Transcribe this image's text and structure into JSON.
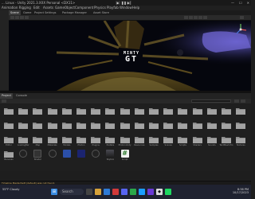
{
  "titlebar": {
    "title": "... Linux - Unity 2021.3.XXX Personal <DX11>",
    "play": "▶",
    "pause": "❚❚",
    "step": "▶|",
    "min": "—",
    "max": "☐",
    "close": "✕"
  },
  "menu": [
    "Animation Rigging",
    "Edit",
    "Assets",
    "GameObject",
    "Component",
    "Physics",
    "Playfab",
    "Window",
    "Help"
  ],
  "scene_tabs": [
    "Scene",
    "Game",
    "Project Settings",
    "Package Manager",
    "Asset Store"
  ],
  "logo": {
    "line1": "MINTY",
    "line2": "GT"
  },
  "project_tabs": [
    "Project",
    "Console"
  ],
  "assets": {
    "folder_rows": [
      [
        "",
        "",
        "",
        "",
        "",
        "",
        "",
        "",
        "",
        "",
        "",
        "",
        "",
        "",
        "",
        "",
        ""
      ],
      [
        "",
        "",
        "",
        "",
        "",
        "",
        "",
        "",
        "",
        "",
        "",
        "",
        "",
        "",
        "",
        "",
        ""
      ],
      [
        "Editor",
        "LoadingBar",
        "Map",
        "Materials",
        "Models",
        "Photon",
        "Plugins",
        "Prefabs",
        "PhotonUnity",
        "Resources",
        "Samples",
        "Scenes",
        "Scripts",
        "Shaders",
        "Sounds",
        "TextMesh Pro",
        "Textures"
      ]
    ],
    "file_row": [
      {
        "label": "Bananas",
        "kind": "folder"
      },
      {
        "label": "",
        "kind": "round-dark"
      },
      {
        "label": "Shader",
        "kind": "dark"
      },
      {
        "label": "",
        "kind": "round-dark"
      },
      {
        "label": "",
        "kind": "blue"
      },
      {
        "label": "",
        "kind": "deepblue"
      },
      {
        "label": "",
        "kind": "round-dark"
      },
      {
        "label": "Skybox",
        "kind": "sky"
      },
      {
        "label": "Script",
        "kind": "hash"
      }
    ]
  },
  "status": "Timeline MasterSett (default) was not found.",
  "taskbar": {
    "weather": "55°F Cloudy",
    "search": "Search",
    "time": "8:38 PM",
    "date": "10/17/2023"
  }
}
